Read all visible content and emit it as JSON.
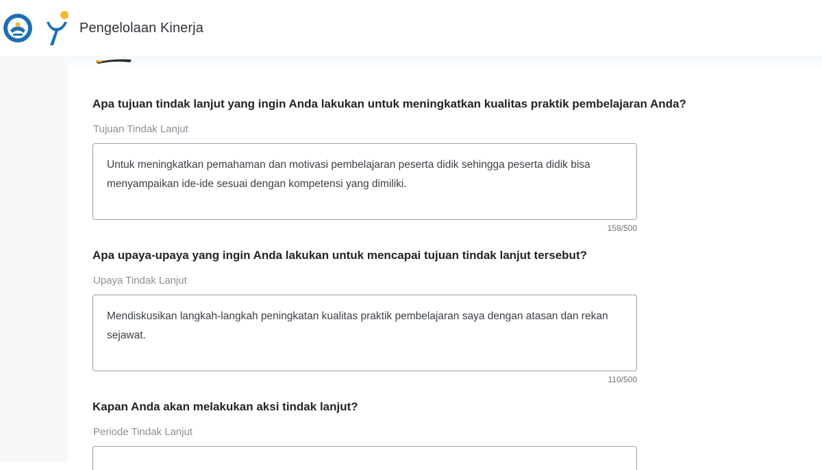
{
  "header": {
    "app_title": "Pengelolaan Kinerja",
    "logo_kemdikbud_icon": "kemdikbud-logo-icon",
    "logo_app_icon": "merdeka-mengajar-logo-icon"
  },
  "form": {
    "q1": {
      "question": "Apa tujuan tindak lanjut yang ingin Anda lakukan untuk meningkatkan kualitas praktik pembelajaran Anda?",
      "label": "Tujuan Tindak Lanjut",
      "value": "Untuk meningkatkan pemahaman dan motivasi pembelajaran peserta didik sehingga peserta didik bisa menyampaikan ide-ide sesuai dengan kompetensi yang dimiliki.",
      "counter": "158/500"
    },
    "q2": {
      "question": "Apa upaya-upaya yang ingin Anda lakukan untuk mencapai tujuan tindak lanjut tersebut?",
      "label": "Upaya Tindak Lanjut",
      "value": "Mendiskusikan langkah-langkah peningkatan kualitas praktik pembelajaran saya dengan atasan dan rekan sejawat.",
      "counter": "110/500"
    },
    "q3": {
      "question": "Kapan Anda akan melakukan aksi tindak lanjut?",
      "label": "Periode Tindak Lanjut"
    }
  },
  "colors": {
    "brand_blue": "#1b6fb8",
    "brand_yellow": "#f5b82e",
    "border": "#9aa0a6"
  }
}
